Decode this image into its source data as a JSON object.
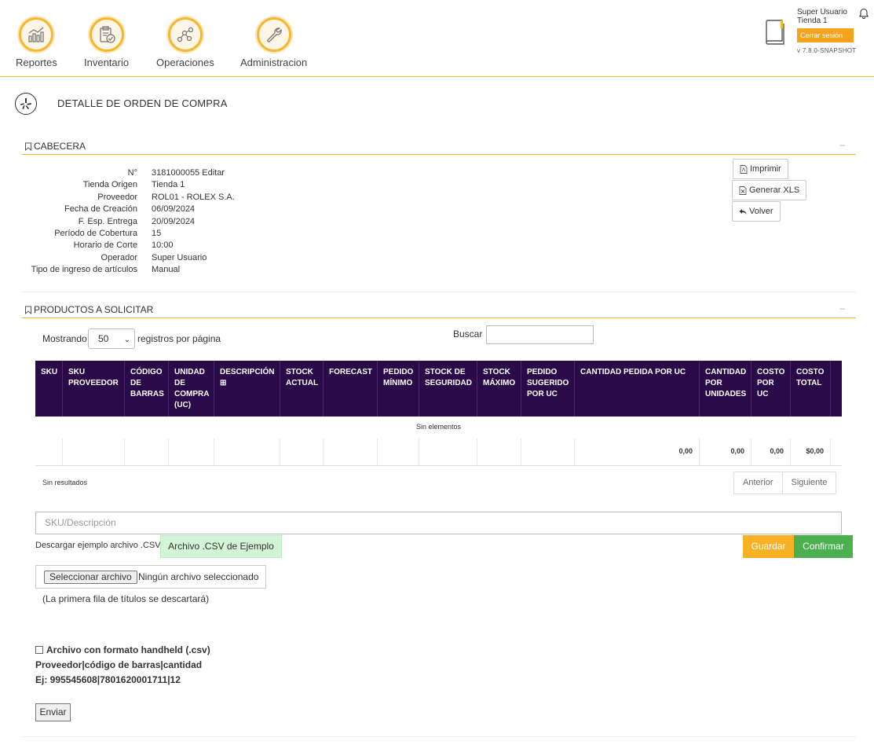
{
  "nav": [
    {
      "label": "Reportes",
      "icon": "chart-icon"
    },
    {
      "label": "Inventario",
      "icon": "clipboard-check-icon"
    },
    {
      "label": "Operaciones",
      "icon": "nodes-icon"
    },
    {
      "label": "Administracion",
      "icon": "wrench-icon"
    }
  ],
  "user": {
    "name": "Super Usuario",
    "store": "Tienda 1",
    "logout": "Cerrar sesión",
    "version": "v 7.8.0-SNAPSHOT"
  },
  "page_title": "DETALLE DE ORDEN DE COMPRA",
  "cabecera": {
    "title": "CABECERA",
    "fields": [
      {
        "k": "N°",
        "v": "3181000055 Editar"
      },
      {
        "k": "Tienda Origen",
        "v": "Tienda 1"
      },
      {
        "k": "Proveedor",
        "v": "ROL01 - ROLEX S.A."
      },
      {
        "k": "Fecha de Creación",
        "v": "06/09/2024"
      },
      {
        "k": "F. Esp. Entrega",
        "v": "20/09/2024"
      },
      {
        "k": "Período de Cobertura",
        "v": "15"
      },
      {
        "k": "Horario de Corte",
        "v": "10:00"
      },
      {
        "k": "Operador",
        "v": "Super Usuario"
      },
      {
        "k": "Tipo de ingreso de artículos",
        "v": "Manual"
      }
    ],
    "btn_print": "Imprimir",
    "btn_xls": "Generar XLS",
    "btn_back": "Volver"
  },
  "productos": {
    "title": "PRODUCTOS A SOLICITAR",
    "showing": "Mostrando",
    "page_size": "50",
    "per_page": "registros por página",
    "search": "Buscar",
    "columns": [
      "SKU",
      "SKU PROVEEDOR",
      "CÓDIGO DE BARRAS",
      "UNIDAD DE COMPRA (UC)",
      "DESCRIPCIÓN ⊞",
      "STOCK ACTUAL",
      "FORECAST",
      "PEDIDO MÍNIMO",
      "STOCK DE SEGURIDAD",
      "STOCK MÁXIMO",
      "PEDIDO SUGERIDO POR UC",
      "CANTIDAD PEDIDA POR UC",
      "CANTIDAD POR UNIDADES",
      "COSTO POR UC",
      "COSTO TOTAL"
    ],
    "empty": "Sin elementos",
    "totals": {
      "cantidad_uc": "0,00",
      "cantidad_unidades": "0,00",
      "costo_uc": "0,00",
      "costo_total": "$0,00"
    },
    "no_results": "Sin resultados",
    "prev": "Anterior",
    "next": "Siguiente"
  },
  "sku_placeholder": "SKU/Descripción",
  "csv": {
    "label": "Descargar ejemplo archivo .CSV",
    "btn": "Archivo .CSV de Ejemplo"
  },
  "btn_save": "Guardar",
  "btn_confirm": "Confirmar",
  "file": {
    "btn": "Seleccionar archivo",
    "none": "Ningún archivo seleccionado",
    "note": "(La primera fila de títulos se descartará)"
  },
  "handheld": {
    "label": "Archivo con formato handheld (.csv)",
    "format": "Proveedor|código de barras|cantidad",
    "example": "Ej: 995545608|7801620001711|12",
    "send": "Enviar"
  },
  "colors": {
    "accent": "#f2c12e",
    "header": "#2b0a4a",
    "save": "#f7b125",
    "confirm": "#4caf50"
  }
}
